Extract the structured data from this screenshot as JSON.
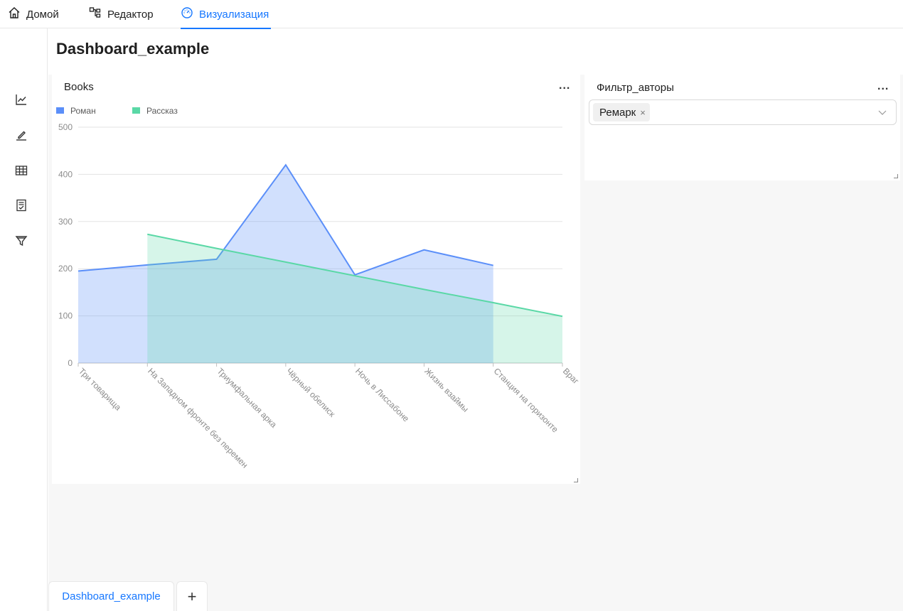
{
  "nav": {
    "tabs": [
      {
        "label": "Домой",
        "icon": "home-icon"
      },
      {
        "label": "Редактор",
        "icon": "editor-schema-icon"
      },
      {
        "label": "Визуализация",
        "icon": "dashboard-gauge-icon",
        "active": true
      }
    ]
  },
  "sidebar": {
    "icons": [
      "line-chart-icon",
      "edit-icon",
      "table-icon",
      "report-icon",
      "filter-icon"
    ]
  },
  "page": {
    "title": "Dashboard_example"
  },
  "chart_panel": {
    "title": "Books",
    "more_label": "...",
    "resize": "resize-handle-icon"
  },
  "filter_panel": {
    "title": "Фильтр_авторы",
    "more_label": "...",
    "selected_tag": "Ремарк",
    "tag_close": "×"
  },
  "bottom_tabs": {
    "active_label": "Dashboard_example",
    "add_label": "+"
  },
  "colors": {
    "accent": "#1677ff",
    "roman": "#5b8ff9",
    "rasskaz": "#5ad8a6"
  },
  "chart_data": {
    "type": "area",
    "title": "Books",
    "categories": [
      "Три товарища",
      "На Западном фронте без перемен",
      "Триумфальная арка",
      "Чёрный обелиск",
      "Ночь в Лиссабоне",
      "Жизнь взаймы",
      "Станция на горизонте",
      "Враг"
    ],
    "ylim": [
      0,
      500
    ],
    "yticks": [
      0,
      100,
      200,
      300,
      400,
      500
    ],
    "grid": true,
    "legend_position": "top-left",
    "series": [
      {
        "name": "Роман",
        "color": "#5b8ff9",
        "values": [
          195,
          208,
          220,
          420,
          187,
          240,
          207,
          null
        ]
      },
      {
        "name": "Рассказ",
        "color": "#5ad8a6",
        "values": [
          null,
          273,
          243,
          214,
          185,
          156,
          128,
          99
        ]
      }
    ]
  }
}
